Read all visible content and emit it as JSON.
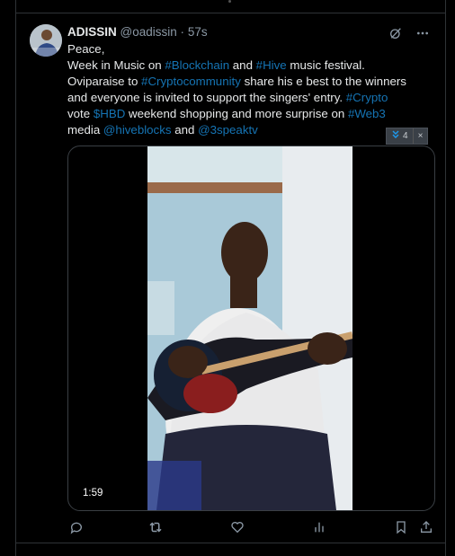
{
  "tweet": {
    "author_name": "ADISSIN",
    "author_handle": "@oadissin",
    "separator": "·",
    "time": "57s",
    "lines": [
      [
        {
          "t": "Peace,",
          "link": false
        }
      ],
      [
        {
          "t": "Week in Music on ",
          "link": false
        },
        {
          "t": "#Blockchain",
          "link": true
        },
        {
          "t": " and ",
          "link": false
        },
        {
          "t": "#Hive",
          "link": true
        },
        {
          "t": " music festival.",
          "link": false
        }
      ],
      [
        {
          "t": "Oviparaise to ",
          "link": false
        },
        {
          "t": "#Cryptocommunity",
          "link": true
        },
        {
          "t": " share his e best to the winners",
          "link": false
        }
      ],
      [
        {
          "t": "and everyone is invited to support the singers' entry. ",
          "link": false
        },
        {
          "t": "#Crypto",
          "link": true
        }
      ],
      [
        {
          "t": "vote ",
          "link": false
        },
        {
          "t": "$HBD",
          "link": true
        },
        {
          "t": " weekend shopping and more  surprise on ",
          "link": false
        },
        {
          "t": "#Web3",
          "link": true
        }
      ],
      [
        {
          "t": "media ",
          "link": false
        },
        {
          "t": "@hiveblocks",
          "link": true
        },
        {
          "t": " and ",
          "link": false
        },
        {
          "t": "@3speaktv",
          "link": true
        }
      ]
    ],
    "badge": {
      "count": "4",
      "close": "×"
    },
    "video_duration": "1:59"
  },
  "colors": {
    "accent": "#1d9bf0",
    "muted": "#8b98a5",
    "background": "#000000",
    "border": "#2f3336"
  },
  "icons": [
    "grok-icon",
    "more-icon",
    "reply-icon",
    "retweet-icon",
    "like-icon",
    "views-icon",
    "bookmark-icon",
    "share-icon"
  ]
}
